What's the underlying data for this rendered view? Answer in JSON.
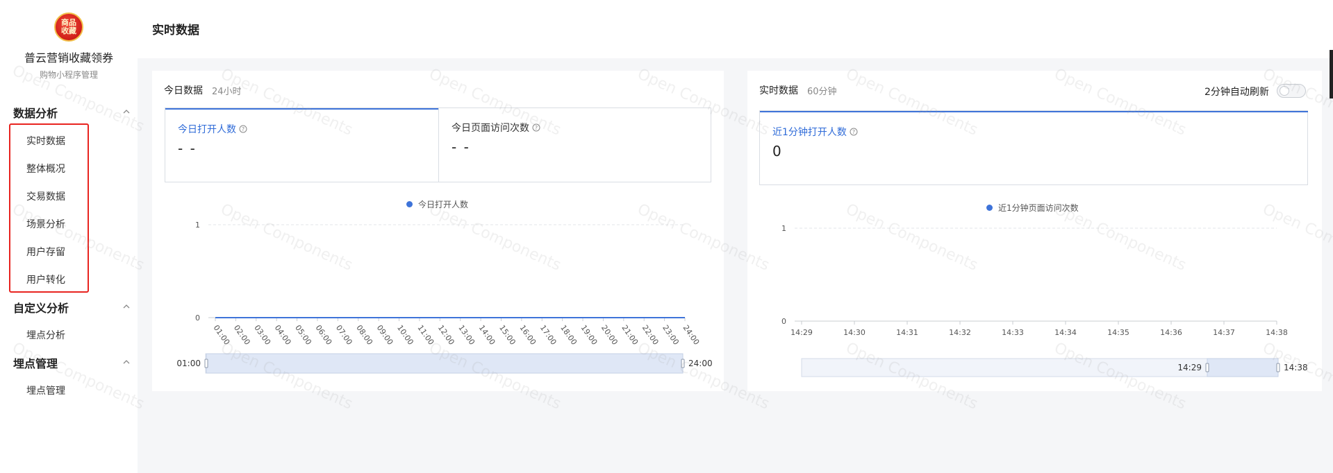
{
  "app": {
    "logo_text": "商品收藏",
    "name": "普云营销收藏领券",
    "subtitle": "购物小程序管理"
  },
  "sidebar": {
    "groups": [
      {
        "title": "数据分析",
        "items": [
          "实时数据",
          "整体概况",
          "交易数据",
          "场景分析",
          "用户存留",
          "用户转化"
        ]
      },
      {
        "title": "自定义分析",
        "items": [
          "埋点分析"
        ]
      },
      {
        "title": "埋点管理",
        "items": [
          "埋点管理"
        ]
      }
    ]
  },
  "page": {
    "title": "实时数据"
  },
  "today_card": {
    "title": "今日数据",
    "sub": "24小时",
    "metrics": [
      {
        "label": "今日打开人数",
        "value": "- -"
      },
      {
        "label": "今日页面访问次数",
        "value": "- -"
      }
    ],
    "legend": "今日打开人数"
  },
  "realtime_card": {
    "title": "实时数据",
    "sub": "60分钟",
    "auto_refresh_label": "2分钟自动刷新",
    "metrics": [
      {
        "label": "近1分钟打开人数",
        "value": "0"
      }
    ],
    "legend": "近1分钟页面访问次数"
  },
  "watermark_text": "Open Components",
  "colors": {
    "accent": "#3e73d9",
    "highlight_box": "#e8231f"
  },
  "chart_data": [
    {
      "type": "line",
      "title": "",
      "series": [
        {
          "name": "今日打开人数",
          "values": [
            0,
            0,
            0,
            0,
            0,
            0,
            0,
            0,
            0,
            0,
            0,
            0,
            0,
            0,
            0,
            0,
            0,
            0,
            0,
            0,
            0,
            0,
            0,
            0
          ]
        }
      ],
      "x": [
        "01:00",
        "02:00",
        "03:00",
        "04:00",
        "05:00",
        "06:00",
        "07:00",
        "08:00",
        "09:00",
        "10:00",
        "11:00",
        "12:00",
        "13:00",
        "14:00",
        "15:00",
        "16:00",
        "17:00",
        "18:00",
        "19:00",
        "20:00",
        "21:00",
        "22:00",
        "23:00",
        "24:00"
      ],
      "y_ticks": [
        "0",
        "1"
      ],
      "ylim": [
        0,
        1
      ],
      "zoom_range": [
        "01:00",
        "24:00"
      ],
      "grid": true,
      "legend_position": "top-center"
    },
    {
      "type": "line",
      "title": "",
      "series": [
        {
          "name": "近1分钟页面访问次数",
          "values": []
        }
      ],
      "x": [
        "14:29",
        "14:30",
        "14:31",
        "14:32",
        "14:33",
        "14:34",
        "14:35",
        "14:36",
        "14:37",
        "14:38"
      ],
      "y_ticks": [
        "0",
        "1"
      ],
      "ylim": [
        0,
        1
      ],
      "zoom_range": [
        "14:29",
        "14:38"
      ],
      "grid": true,
      "legend_position": "top-center"
    }
  ]
}
